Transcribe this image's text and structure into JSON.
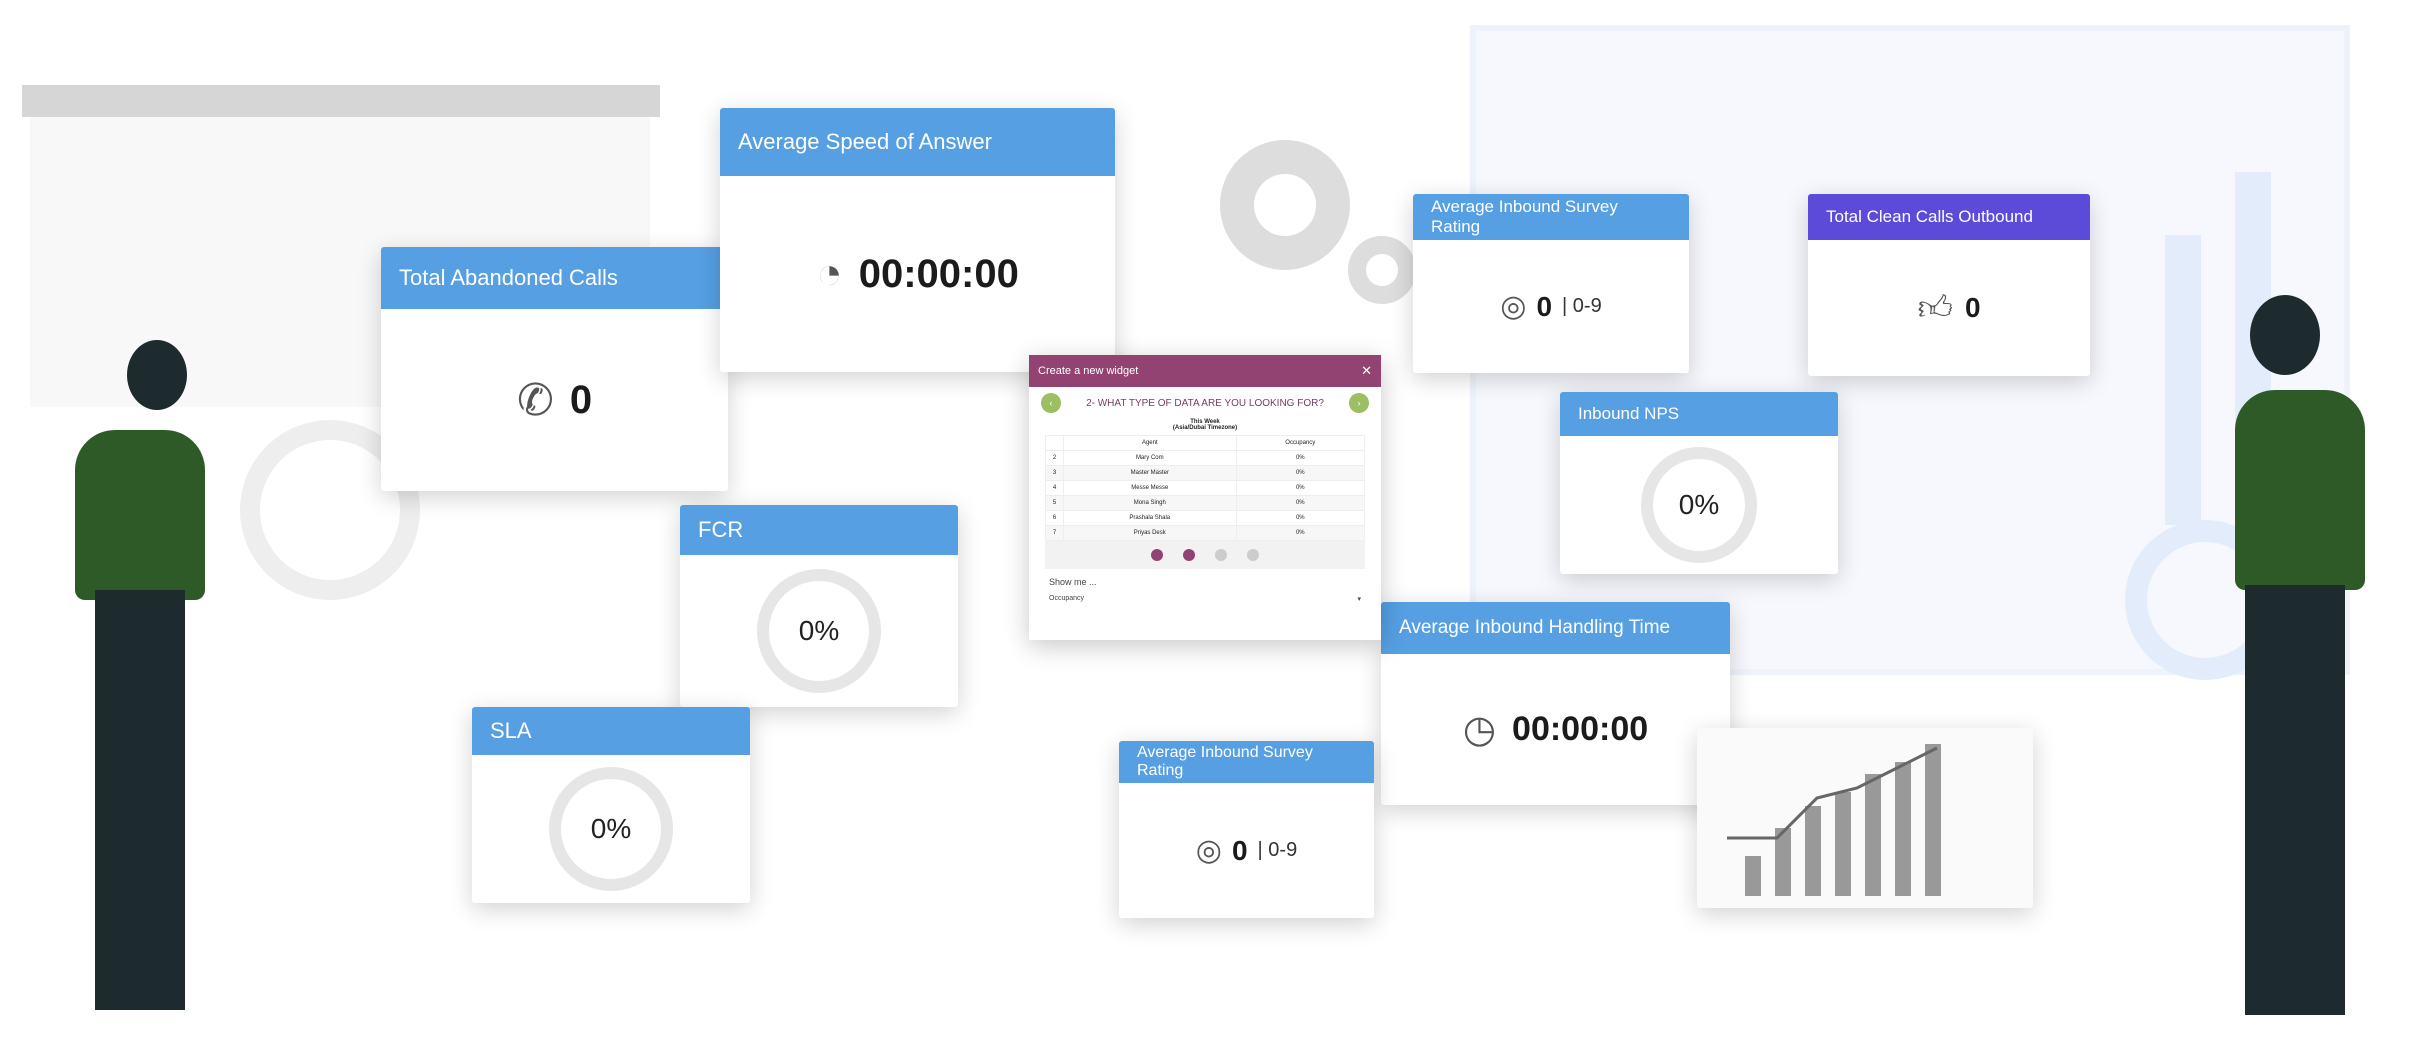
{
  "widgets": {
    "abandoned": {
      "title": "Total Abandoned Calls",
      "value": "0",
      "icon": "phone-missed-icon"
    },
    "asa": {
      "title": "Average Speed of Answer",
      "value": "00:00:00",
      "icon": "timer-icon"
    },
    "fcr": {
      "title": "FCR",
      "value": "0%"
    },
    "sla": {
      "title": "SLA",
      "value": "0%"
    },
    "survey_top": {
      "title": "Average Inbound Survey Rating",
      "value": "0",
      "range": "| 0-9",
      "icon": "rating-icon"
    },
    "clean_calls": {
      "title": "Total Clean Calls Outbound",
      "value": "0",
      "icon": "thumbs-up-icon",
      "color": "#5b4bd8"
    },
    "nps": {
      "title": "Inbound NPS",
      "value": "0%"
    },
    "aht": {
      "title": "Average Inbound Handling Time",
      "value": "00:00:00",
      "icon": "phone-clock-icon"
    },
    "survey_bottom": {
      "title": "Average Inbound Survey Rating",
      "value": "0",
      "range": "| 0-9",
      "icon": "rating-icon"
    }
  },
  "modal": {
    "title": "Create a new widget",
    "question": "2- WHAT TYPE OF DATA ARE YOU LOOKING FOR?",
    "period": "This Week",
    "timezone": "(Asia/Dubai Timezone)",
    "columns": [
      "",
      "Agent",
      "Occupancy"
    ],
    "rows": [
      [
        "2",
        "Mary Com",
        "0%"
      ],
      [
        "3",
        "Master Master",
        "0%"
      ],
      [
        "4",
        "Messe Messe",
        "0%"
      ],
      [
        "5",
        "Mona Singh",
        "0%"
      ],
      [
        "6",
        "Prashala Shala",
        "0%"
      ],
      [
        "7",
        "Priyas Desk",
        "0%"
      ]
    ],
    "show_label": "Show me ...",
    "select_value": "Occupancy",
    "header_color": "#934371",
    "accent": "#9cbf64"
  },
  "colors": {
    "header": "#559fe2"
  }
}
